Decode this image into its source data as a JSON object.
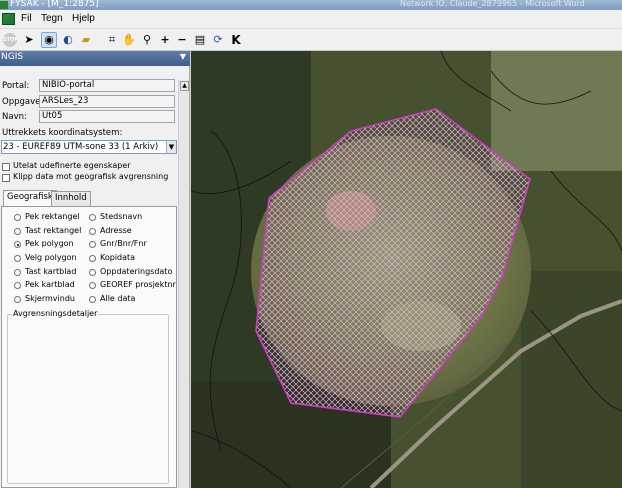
{
  "window": {
    "title": "FYSAK - [M_1:2875]",
    "right_text": "Network IO, Claude_2879965 - Microsoft Word"
  },
  "menu": {
    "items": [
      "Fil",
      "Tegn",
      "Hjelp"
    ]
  },
  "toolbar": {
    "stop_label": "STOP",
    "buttons": [
      "stop-icon",
      "pointer-icon",
      "globe-icon",
      "globe-arrow-icon",
      "open-folder-icon",
      "zoom-extent-icon",
      "pan-icon",
      "zoom-icon",
      "zoom-in-icon",
      "zoom-out-icon",
      "print-icon",
      "refresh-icon",
      "k-icon"
    ]
  },
  "panel": {
    "title": "NGIS",
    "fields": [
      {
        "label": "Portal:",
        "value": "NIBIO-portal"
      },
      {
        "label": "Oppgave:",
        "value": "ARSLes_23"
      },
      {
        "label": "Navn:",
        "value": "Ut05"
      }
    ],
    "coord_label": "Uttrekkets koordinatsystem:",
    "coord_value": "23 - EUREF89 UTM-sone 33 (1 Arkiv)",
    "checkboxes": [
      {
        "label": "Utelat udefinerte egenskaper",
        "checked": false
      },
      {
        "label": "Klipp data mot geografisk avgrensning",
        "checked": false
      }
    ],
    "tabs": [
      "Geografisk",
      "Innhold"
    ],
    "active_tab": "Geografisk",
    "options_left": [
      "Pek rektangel",
      "Tast rektangel",
      "Pek polygon",
      "Velg polygon",
      "Tast kartblad",
      "Pek kartblad",
      "Skjermvindu"
    ],
    "options_right": [
      "Stedsnavn",
      "Adresse",
      "Gnr/Bnr/Fnr",
      "Kopidata",
      "Oppdateringsdato",
      "GEOREF prosjektnr",
      "Alle data"
    ],
    "selected_option": "Pek polygon",
    "group_title": "Avgrensningsdetaljer"
  },
  "map": {
    "polygon_color": "#d23cc8",
    "description_icon": "aerial-photo"
  }
}
